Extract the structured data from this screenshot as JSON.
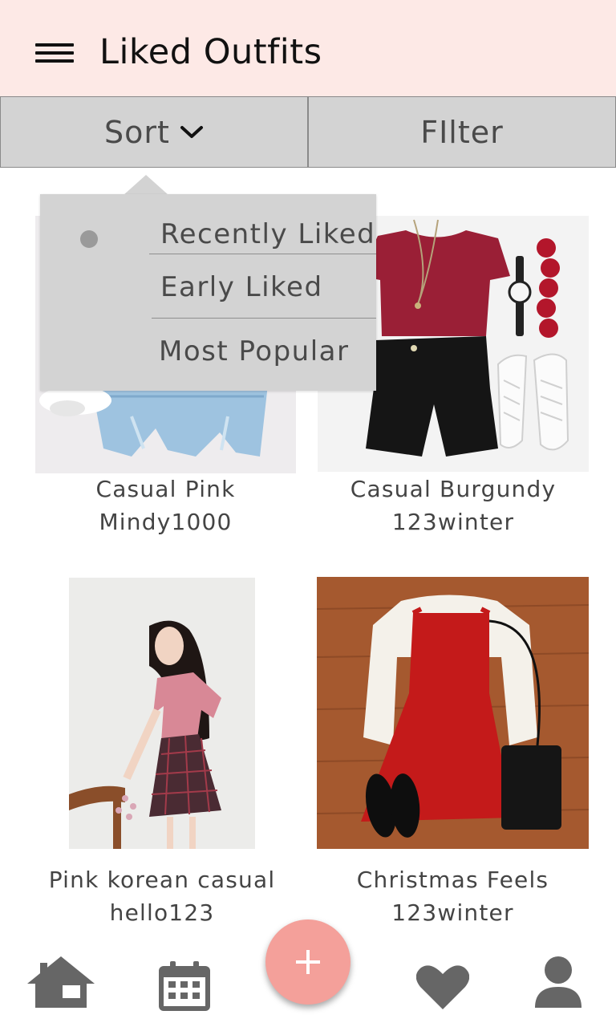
{
  "appbar": {
    "title": "Liked Outfits",
    "menu_icon": "menu-icon"
  },
  "toolbar": {
    "sort_label": "Sort",
    "filter_label": "FIlter"
  },
  "sort_menu": {
    "items": [
      "Recently Liked",
      "Early Liked",
      "Most Popular"
    ],
    "selected": "Recently Liked"
  },
  "outfits": [
    {
      "title": "Casual Pink",
      "user": "Mindy1000"
    },
    {
      "title": "Casual Burgundy",
      "user": "123winter"
    },
    {
      "title": "Pink korean casual",
      "user": "hello123"
    },
    {
      "title": "Christmas Feels",
      "user": "123winter"
    }
  ],
  "bottom_nav": {
    "icons": [
      "home-icon",
      "calendar-icon",
      "add-icon",
      "heart-icon",
      "profile-icon"
    ]
  },
  "colors": {
    "appbar_bg": "#fde9e6",
    "toolbar_bg": "#d3d3d3",
    "fab": "#f4a09a",
    "nav_icon": "#666666"
  }
}
